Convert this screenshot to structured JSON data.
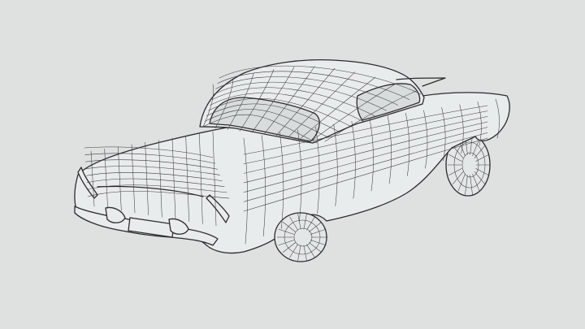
{
  "scene": {
    "subject": "car-wireframe-model",
    "colors": {
      "background": "#dfe0e0",
      "surface": "#e9ecec",
      "wire": "#2a2c2e"
    }
  }
}
